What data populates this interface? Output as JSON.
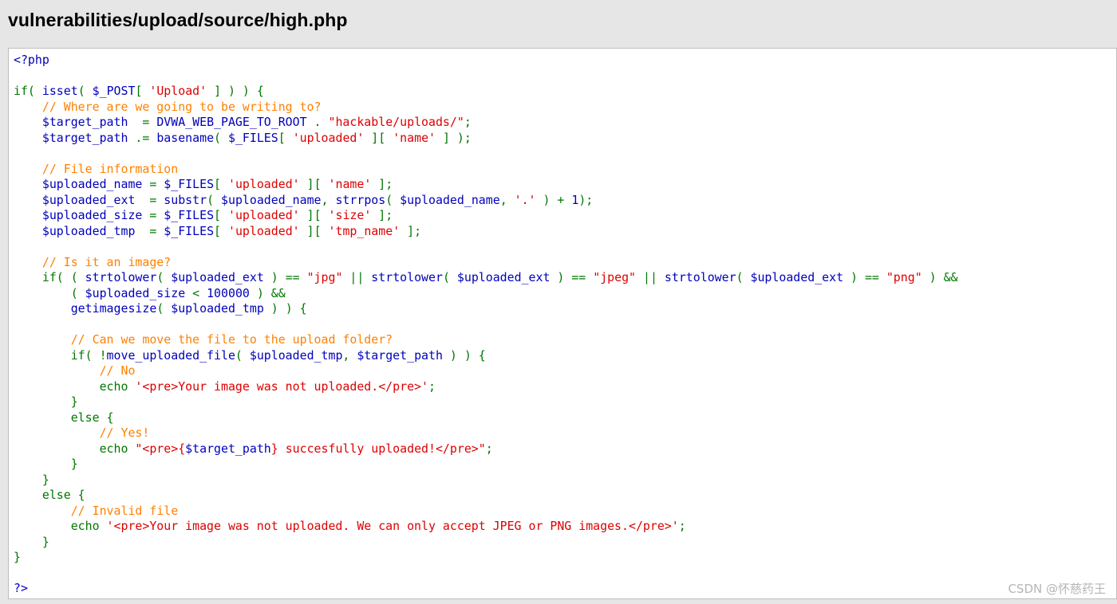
{
  "header": {
    "title": "vulnerabilities/upload/source/high.php"
  },
  "colors": {
    "default": "#0000bb",
    "keyword": "#007700",
    "string": "#dd0000",
    "comment": "#ff8000",
    "background": "#ffffff"
  },
  "code": {
    "lines": [
      [
        {
          "t": "default",
          "v": "<?php"
        }
      ],
      [],
      [
        {
          "t": "keyword",
          "v": "if( "
        },
        {
          "t": "default",
          "v": "isset"
        },
        {
          "t": "keyword",
          "v": "( "
        },
        {
          "t": "default",
          "v": "$_POST"
        },
        {
          "t": "keyword",
          "v": "[ "
        },
        {
          "t": "string",
          "v": "'Upload'"
        },
        {
          "t": "keyword",
          "v": " ] ) ) {"
        }
      ],
      [
        {
          "t": "comment",
          "v": "    // Where are we going to be writing to?"
        }
      ],
      [
        {
          "t": "default",
          "v": "    $target_path  "
        },
        {
          "t": "keyword",
          "v": "= "
        },
        {
          "t": "default",
          "v": "DVWA_WEB_PAGE_TO_ROOT "
        },
        {
          "t": "keyword",
          "v": ". "
        },
        {
          "t": "string",
          "v": "\"hackable/uploads/\""
        },
        {
          "t": "keyword",
          "v": ";"
        }
      ],
      [
        {
          "t": "default",
          "v": "    $target_path "
        },
        {
          "t": "keyword",
          "v": ".= "
        },
        {
          "t": "default",
          "v": "basename"
        },
        {
          "t": "keyword",
          "v": "( "
        },
        {
          "t": "default",
          "v": "$_FILES"
        },
        {
          "t": "keyword",
          "v": "[ "
        },
        {
          "t": "string",
          "v": "'uploaded'"
        },
        {
          "t": "keyword",
          "v": " ][ "
        },
        {
          "t": "string",
          "v": "'name'"
        },
        {
          "t": "keyword",
          "v": " ] );"
        }
      ],
      [],
      [
        {
          "t": "comment",
          "v": "    // File information"
        }
      ],
      [
        {
          "t": "default",
          "v": "    $uploaded_name "
        },
        {
          "t": "keyword",
          "v": "= "
        },
        {
          "t": "default",
          "v": "$_FILES"
        },
        {
          "t": "keyword",
          "v": "[ "
        },
        {
          "t": "string",
          "v": "'uploaded'"
        },
        {
          "t": "keyword",
          "v": " ][ "
        },
        {
          "t": "string",
          "v": "'name'"
        },
        {
          "t": "keyword",
          "v": " ];"
        }
      ],
      [
        {
          "t": "default",
          "v": "    $uploaded_ext  "
        },
        {
          "t": "keyword",
          "v": "= "
        },
        {
          "t": "default",
          "v": "substr"
        },
        {
          "t": "keyword",
          "v": "( "
        },
        {
          "t": "default",
          "v": "$uploaded_name"
        },
        {
          "t": "keyword",
          "v": ", "
        },
        {
          "t": "default",
          "v": "strrpos"
        },
        {
          "t": "keyword",
          "v": "( "
        },
        {
          "t": "default",
          "v": "$uploaded_name"
        },
        {
          "t": "keyword",
          "v": ", "
        },
        {
          "t": "string",
          "v": "'.'"
        },
        {
          "t": "keyword",
          "v": " ) + "
        },
        {
          "t": "default",
          "v": "1"
        },
        {
          "t": "keyword",
          "v": ");"
        }
      ],
      [
        {
          "t": "default",
          "v": "    $uploaded_size "
        },
        {
          "t": "keyword",
          "v": "= "
        },
        {
          "t": "default",
          "v": "$_FILES"
        },
        {
          "t": "keyword",
          "v": "[ "
        },
        {
          "t": "string",
          "v": "'uploaded'"
        },
        {
          "t": "keyword",
          "v": " ][ "
        },
        {
          "t": "string",
          "v": "'size'"
        },
        {
          "t": "keyword",
          "v": " ];"
        }
      ],
      [
        {
          "t": "default",
          "v": "    $uploaded_tmp  "
        },
        {
          "t": "keyword",
          "v": "= "
        },
        {
          "t": "default",
          "v": "$_FILES"
        },
        {
          "t": "keyword",
          "v": "[ "
        },
        {
          "t": "string",
          "v": "'uploaded'"
        },
        {
          "t": "keyword",
          "v": " ][ "
        },
        {
          "t": "string",
          "v": "'tmp_name'"
        },
        {
          "t": "keyword",
          "v": " ];"
        }
      ],
      [],
      [
        {
          "t": "comment",
          "v": "    // Is it an image?"
        }
      ],
      [
        {
          "t": "keyword",
          "v": "    if( ( "
        },
        {
          "t": "default",
          "v": "strtolower"
        },
        {
          "t": "keyword",
          "v": "( "
        },
        {
          "t": "default",
          "v": "$uploaded_ext "
        },
        {
          "t": "keyword",
          "v": ") == "
        },
        {
          "t": "string",
          "v": "\"jpg\""
        },
        {
          "t": "keyword",
          "v": " || "
        },
        {
          "t": "default",
          "v": "strtolower"
        },
        {
          "t": "keyword",
          "v": "( "
        },
        {
          "t": "default",
          "v": "$uploaded_ext "
        },
        {
          "t": "keyword",
          "v": ") == "
        },
        {
          "t": "string",
          "v": "\"jpeg\""
        },
        {
          "t": "keyword",
          "v": " || "
        },
        {
          "t": "default",
          "v": "strtolower"
        },
        {
          "t": "keyword",
          "v": "( "
        },
        {
          "t": "default",
          "v": "$uploaded_ext "
        },
        {
          "t": "keyword",
          "v": ") == "
        },
        {
          "t": "string",
          "v": "\"png\""
        },
        {
          "t": "keyword",
          "v": " ) &&"
        }
      ],
      [
        {
          "t": "keyword",
          "v": "        ( "
        },
        {
          "t": "default",
          "v": "$uploaded_size "
        },
        {
          "t": "keyword",
          "v": "< "
        },
        {
          "t": "default",
          "v": "100000 "
        },
        {
          "t": "keyword",
          "v": ") &&"
        }
      ],
      [
        {
          "t": "default",
          "v": "        getimagesize"
        },
        {
          "t": "keyword",
          "v": "( "
        },
        {
          "t": "default",
          "v": "$uploaded_tmp "
        },
        {
          "t": "keyword",
          "v": ") ) {"
        }
      ],
      [],
      [
        {
          "t": "comment",
          "v": "        // Can we move the file to the upload folder?"
        }
      ],
      [
        {
          "t": "keyword",
          "v": "        if( !"
        },
        {
          "t": "default",
          "v": "move_uploaded_file"
        },
        {
          "t": "keyword",
          "v": "( "
        },
        {
          "t": "default",
          "v": "$uploaded_tmp"
        },
        {
          "t": "keyword",
          "v": ", "
        },
        {
          "t": "default",
          "v": "$target_path "
        },
        {
          "t": "keyword",
          "v": ") ) {"
        }
      ],
      [
        {
          "t": "comment",
          "v": "            // No"
        }
      ],
      [
        {
          "t": "keyword",
          "v": "            echo "
        },
        {
          "t": "string",
          "v": "'<pre>Your image was not uploaded.</pre>'"
        },
        {
          "t": "keyword",
          "v": ";"
        }
      ],
      [
        {
          "t": "keyword",
          "v": "        }"
        }
      ],
      [
        {
          "t": "keyword",
          "v": "        else {"
        }
      ],
      [
        {
          "t": "comment",
          "v": "            // Yes!"
        }
      ],
      [
        {
          "t": "keyword",
          "v": "            echo "
        },
        {
          "t": "string",
          "v": "\"<pre>{"
        },
        {
          "t": "default",
          "v": "$target_path"
        },
        {
          "t": "string",
          "v": "} succesfully uploaded!</pre>\""
        },
        {
          "t": "keyword",
          "v": ";"
        }
      ],
      [
        {
          "t": "keyword",
          "v": "        }"
        }
      ],
      [
        {
          "t": "keyword",
          "v": "    }"
        }
      ],
      [
        {
          "t": "keyword",
          "v": "    else {"
        }
      ],
      [
        {
          "t": "comment",
          "v": "        // Invalid file"
        }
      ],
      [
        {
          "t": "keyword",
          "v": "        echo "
        },
        {
          "t": "string",
          "v": "'<pre>Your image was not uploaded. We can only accept JPEG or PNG images.</pre>'"
        },
        {
          "t": "keyword",
          "v": ";"
        }
      ],
      [
        {
          "t": "keyword",
          "v": "    }"
        }
      ],
      [
        {
          "t": "keyword",
          "v": "}"
        }
      ],
      [],
      [
        {
          "t": "default",
          "v": "?>"
        }
      ]
    ]
  },
  "watermark": {
    "text": "CSDN @怀慈药王"
  }
}
